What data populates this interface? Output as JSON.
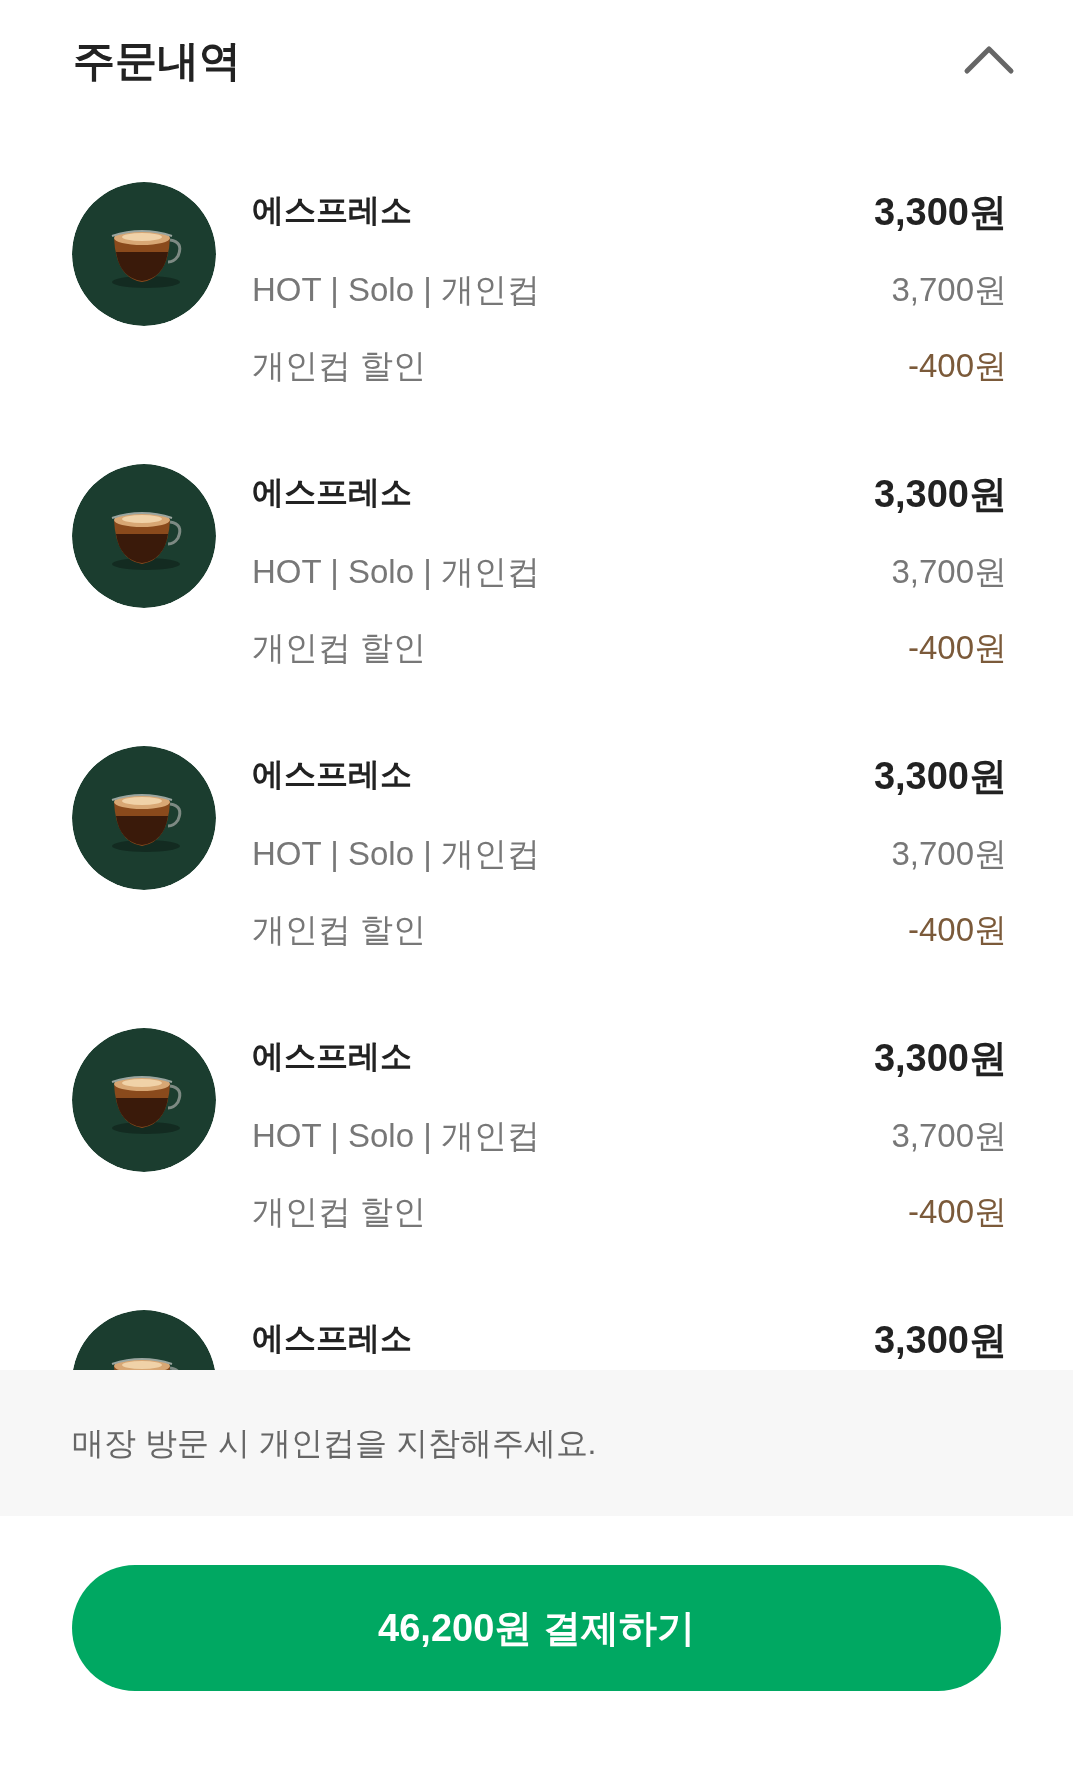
{
  "header": {
    "title": "주문내역",
    "expanded": true
  },
  "items": [
    {
      "name": "에스프레소",
      "price": "3,300원",
      "options": "HOT | Solo | 개인컵",
      "original_price": "3,700원",
      "discount_label": "개인컵 할인",
      "discount": "-400원"
    },
    {
      "name": "에스프레소",
      "price": "3,300원",
      "options": "HOT | Solo | 개인컵",
      "original_price": "3,700원",
      "discount_label": "개인컵 할인",
      "discount": "-400원"
    },
    {
      "name": "에스프레소",
      "price": "3,300원",
      "options": "HOT | Solo | 개인컵",
      "original_price": "3,700원",
      "discount_label": "개인컵 할인",
      "discount": "-400원"
    },
    {
      "name": "에스프레소",
      "price": "3,300원",
      "options": "HOT | Solo | 개인컵",
      "original_price": "3,700원",
      "discount_label": "개인컵 할인",
      "discount": "-400원"
    },
    {
      "name": "에스프레소",
      "price": "3,300원"
    }
  ],
  "notice": "매장 방문 시 개인컵을 지참해주세요.",
  "pay_button": "46,200원 결제하기"
}
